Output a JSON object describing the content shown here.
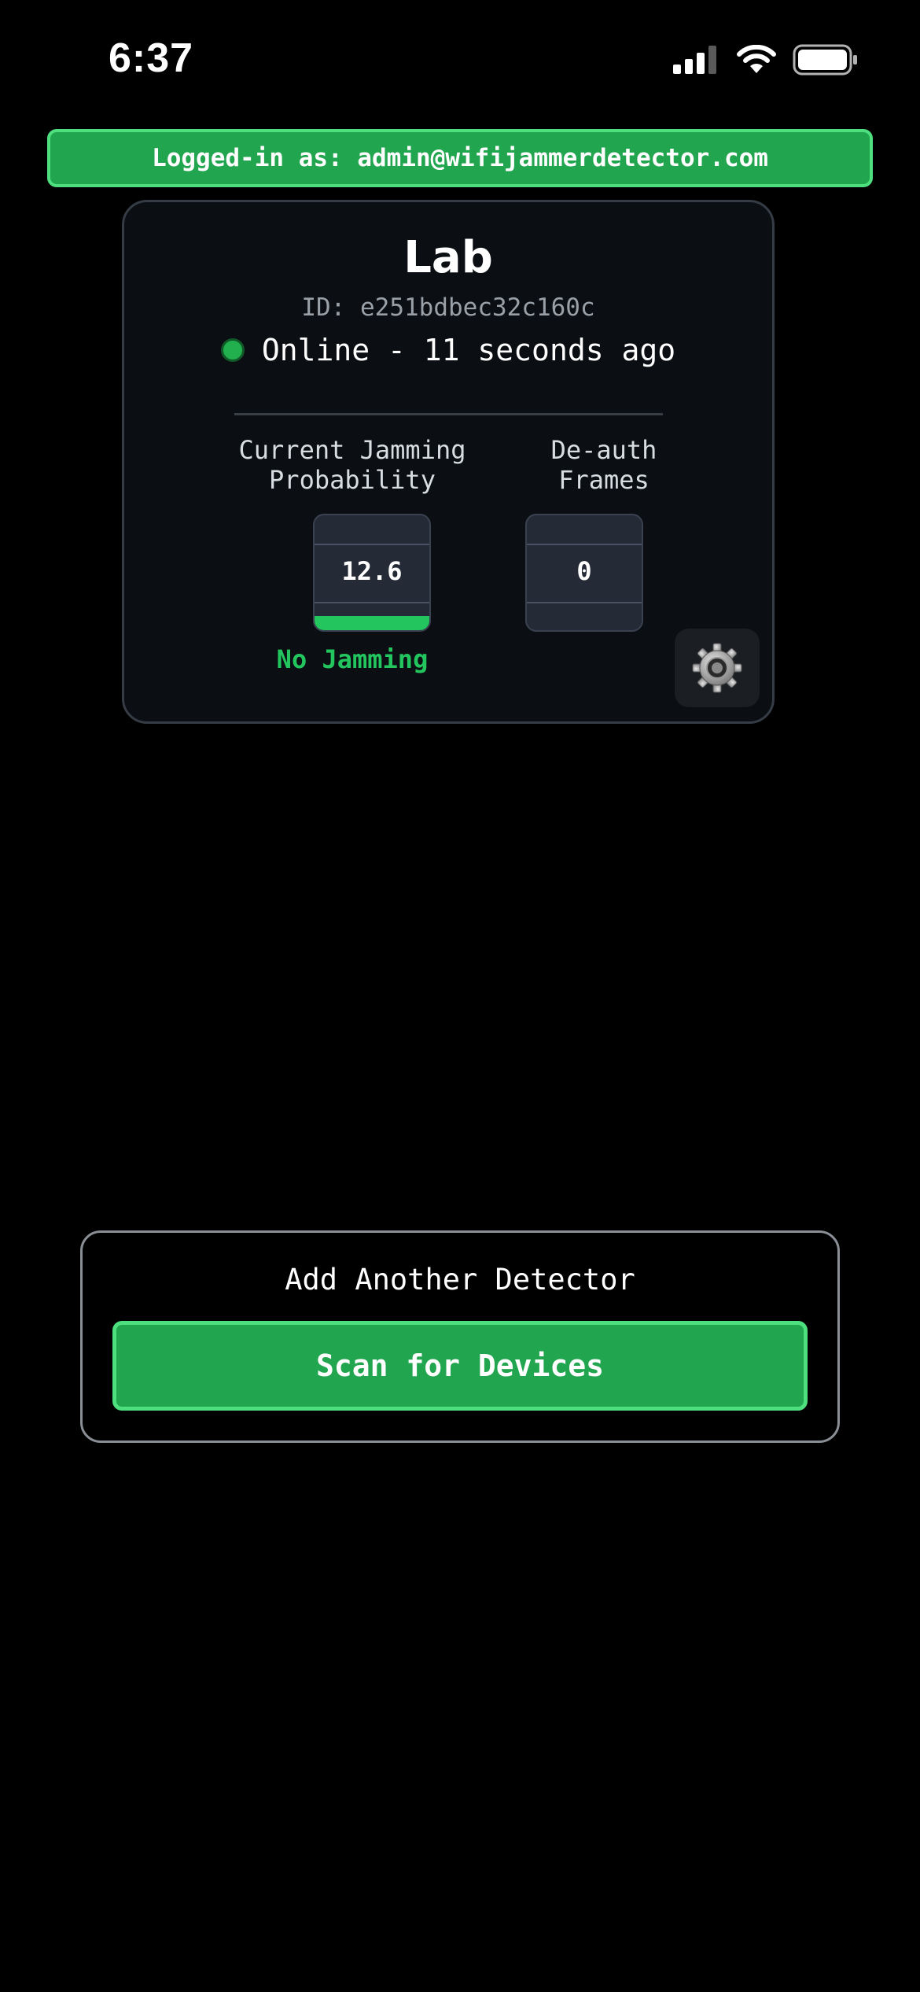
{
  "status_bar": {
    "time": "6:37",
    "signal_icon": "cellular-signal-icon",
    "wifi_icon": "wifi-icon",
    "battery_icon": "battery-icon"
  },
  "login_banner": {
    "text": "Logged-in as: admin@wifijammerdetector.com"
  },
  "device": {
    "name": "Lab",
    "id_text": "ID: e251bdbec32c160c",
    "status_text": "Online - 11 seconds ago",
    "status_color": "#22b04f",
    "jamming": {
      "label_line1": "Current Jamming",
      "label_line2": "Probability",
      "value": "12.6",
      "fill_fraction": 0.126,
      "status": "No Jamming",
      "status_color": "#22c55e"
    },
    "deauth": {
      "label_line1": "De-auth",
      "label_line2": "Frames",
      "value": "0"
    },
    "settings_icon": "gear-icon"
  },
  "add_detector": {
    "title": "Add Another Detector",
    "button_label": "Scan for Devices"
  },
  "colors": {
    "accent_green": "#22a54f",
    "accent_border": "#4ee07f",
    "background": "#000000"
  }
}
